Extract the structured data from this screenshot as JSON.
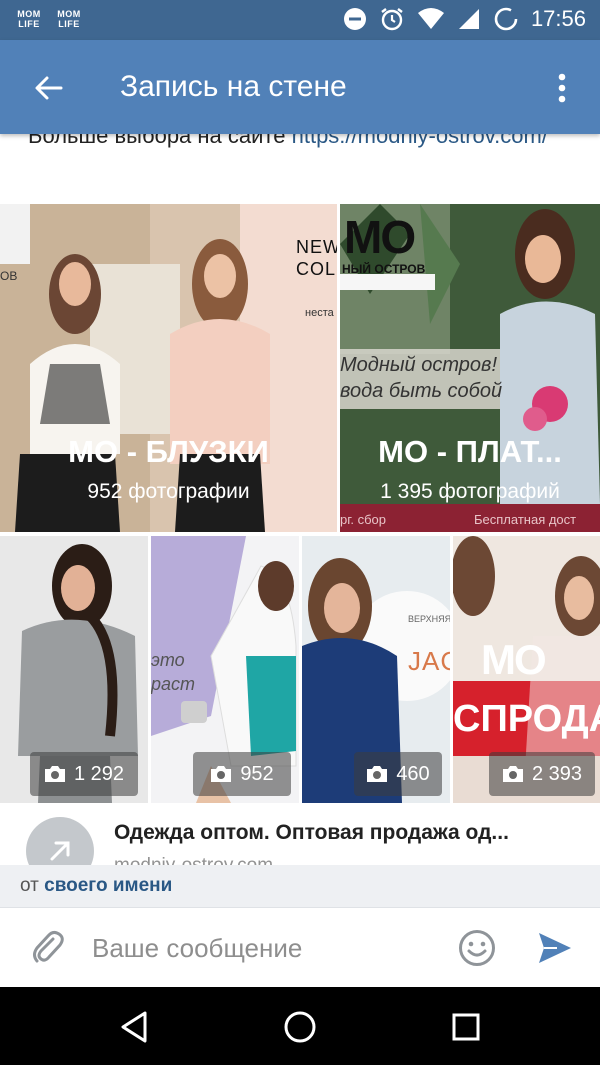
{
  "status_bar": {
    "time": "17:56",
    "app_logos": [
      [
        "MOM",
        "LIFE"
      ],
      [
        "MOM",
        "LIFE"
      ]
    ],
    "icons": [
      "do-not-disturb-icon",
      "alarm-icon",
      "wifi-icon",
      "signal-icon",
      "battery-icon"
    ]
  },
  "app_bar": {
    "title": "Запись на стене"
  },
  "post": {
    "text_prefix": "Больше выбора на сайте ",
    "link_text": "https://modniy-ostrov.com/"
  },
  "albums": [
    {
      "title": "МО - БЛУЗКИ",
      "subtitle": "952 фотографии",
      "overlay_text": "NEW COL",
      "side_text": "ОВ",
      "small_text": "неста"
    },
    {
      "title": "МО - ПЛАТ...",
      "subtitle": "1 395 фотографий",
      "brand": "МО",
      "brand_sub": "НЫЙ ОСТРОВ",
      "sign_lines": [
        "Модный остров!",
        "вода быть собой"
      ],
      "footer_left": "рг. сбор",
      "footer_right": "Бесплатная дост"
    }
  ],
  "photos": [
    {
      "count": "1 292",
      "overlay": ""
    },
    {
      "count": "952",
      "overlay": "это\nраст"
    },
    {
      "count": "460",
      "overlay": "JAC",
      "small": "ВЕРХНЯЯ"
    },
    {
      "count": "2 393",
      "overlay": "СПРОДА",
      "brand": "МО"
    }
  ],
  "link_preview": {
    "title": "Одежда оптом. Оптовая продажа од...",
    "domain": "modniy-ostrov.com"
  },
  "from_bar": {
    "prefix": "от",
    "name": "своего имени"
  },
  "composer": {
    "placeholder": "Ваше сообщение"
  },
  "colors": {
    "status_bar": "#3f6791",
    "app_bar": "#5181b8",
    "link": "#2a5885",
    "send": "#5181b8"
  }
}
